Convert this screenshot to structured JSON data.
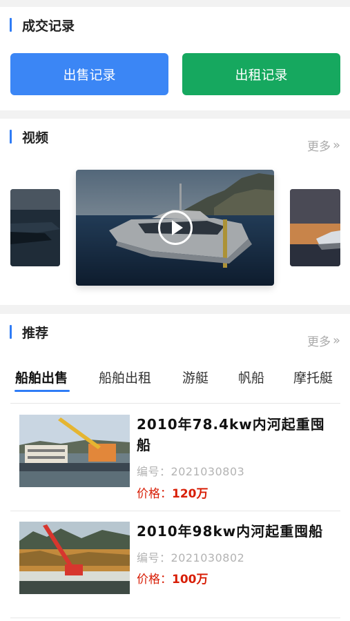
{
  "records": {
    "title": "成交记录",
    "sale_label": "出售记录",
    "rent_label": "出租记录"
  },
  "video": {
    "title": "视频",
    "more_label": "更多",
    "more_icon": "double-chevron-right-icon"
  },
  "recommend": {
    "title": "推荐",
    "more_label": "更多",
    "tabs": [
      {
        "label": "船舶出售",
        "active": true
      },
      {
        "label": "船舶出租",
        "active": false
      },
      {
        "label": "游艇",
        "active": false
      },
      {
        "label": "帆船",
        "active": false
      },
      {
        "label": "摩托艇",
        "active": false
      }
    ],
    "items": [
      {
        "name": "2010年78.4kw内河起重囤船",
        "code_label": "编号：",
        "code": "2021030803",
        "price_label": "价格：",
        "price": "120万"
      },
      {
        "name": "2010年98kw内河起重囤船",
        "code_label": "编号：",
        "code": "2021030802",
        "price_label": "价格：",
        "price": "100万"
      }
    ]
  },
  "colors": {
    "accent": "#2f7cf6",
    "sale_button": "#3b86f5",
    "rent_button": "#16a85f",
    "price": "#d81e06"
  }
}
